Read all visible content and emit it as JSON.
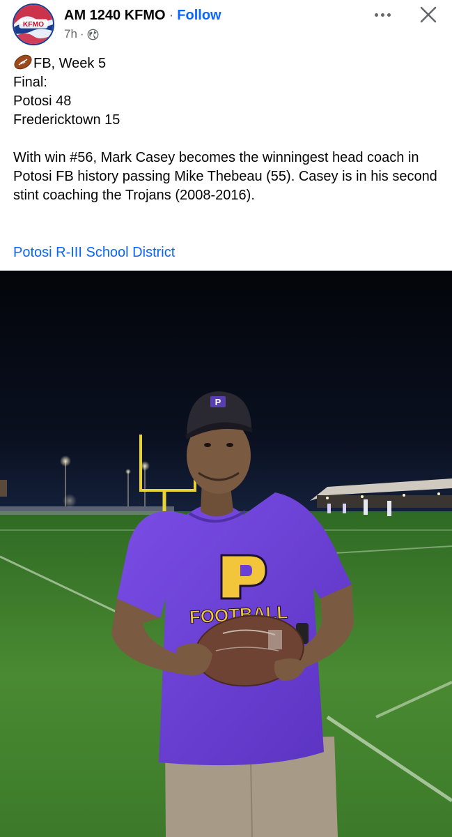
{
  "header": {
    "page_name": "AM 1240 KFMO",
    "separator": "·",
    "follow_label": "Follow",
    "time_ago": "7h",
    "meta_separator": "·",
    "privacy_icon": "globe-icon",
    "more_icon": "more-dots-icon",
    "close_icon": "close-icon",
    "avatar_text": "KFMO"
  },
  "post": {
    "line1": "FB, Week 5",
    "line1_emoji": "football-emoji",
    "line2": "Final:",
    "line3": "Potosi 48",
    "line4": "Fredericktown 15",
    "paragraph": "With win #56, Mark Casey becomes the winningest head coach in Potosi FB history passing Mike Thebeau (55). Casey is in his second stint coaching the Trojans (2008-2016).",
    "tag_link": "Potosi R-III School District"
  },
  "photo": {
    "cap_letter": "P",
    "shirt_letter": "P",
    "shirt_text": "FOOTBALL"
  },
  "colors": {
    "link": "#0866ff",
    "secondary_text": "#65676b",
    "shirt": "#6a3fd6",
    "field": "#3d7a2c"
  }
}
